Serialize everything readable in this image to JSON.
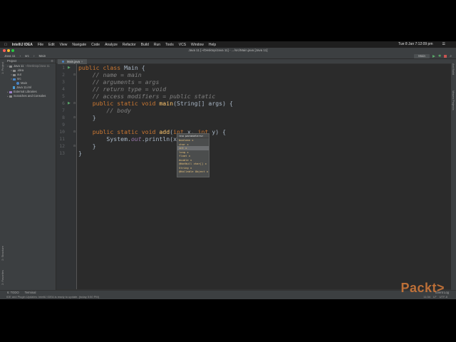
{
  "menubar": {
    "apple": "",
    "app": "IntelliJ IDEA",
    "items": [
      "File",
      "Edit",
      "View",
      "Navigate",
      "Code",
      "Analyze",
      "Refactor",
      "Build",
      "Run",
      "Tools",
      "VCS",
      "Window",
      "Help"
    ],
    "clock": "Tue 8 Jan 7:12:09 pm"
  },
  "window": {
    "title": "Java 11 [~/Desktop/Java 11] - .../src/Main.java [Java 11]"
  },
  "navbar": {
    "crumbs": [
      "Java 11",
      "src",
      "Main"
    ],
    "run_config": "Main"
  },
  "project_panel": {
    "title": "Project",
    "tree": [
      {
        "label": "Java 11",
        "hint": "~/Desktop/Java 11",
        "indent": 0,
        "icon": "folder"
      },
      {
        "label": ".idea",
        "hint": "",
        "indent": 1,
        "icon": "folder"
      },
      {
        "label": "out",
        "hint": "",
        "indent": 1,
        "icon": "folder"
      },
      {
        "label": "src",
        "hint": "",
        "indent": 1,
        "icon": "folder-src"
      },
      {
        "label": "Main",
        "hint": "",
        "indent": 2,
        "icon": "class"
      },
      {
        "label": "Java 11.iml",
        "hint": "",
        "indent": 1,
        "icon": "file"
      },
      {
        "label": "External Libraries",
        "hint": "",
        "indent": 0,
        "icon": "lib"
      },
      {
        "label": "Scratches and Consoles",
        "hint": "",
        "indent": 0,
        "icon": "folder"
      }
    ]
  },
  "left_strip": {
    "top": "1: Project",
    "middle": "2: Structure",
    "bottom": "2: Favorites"
  },
  "right_strip": {
    "top": "Ant Build",
    "middle": "Maven Projects"
  },
  "editor": {
    "tab": "Main.java",
    "line_numbers": [
      "1",
      "2",
      "3",
      "4",
      "5",
      "6",
      "7",
      "8",
      "9",
      "10",
      "11",
      "12",
      "13"
    ],
    "code": [
      [
        [
          "kw",
          "public class "
        ],
        [
          "",
          "Main {"
        ]
      ],
      [
        [
          "cm",
          "    // name = main"
        ]
      ],
      [
        [
          "cm",
          "    // arguments = args"
        ]
      ],
      [
        [
          "cm",
          "    // return type = void"
        ]
      ],
      [
        [
          "cm",
          "    // access modifiers = public static"
        ]
      ],
      [
        [
          "kw",
          "    public static void "
        ],
        [
          "fn",
          "main"
        ],
        [
          "",
          "(String[] args) {"
        ]
      ],
      [
        [
          "cm",
          "        // body"
        ]
      ],
      [
        [
          "",
          "    }"
        ]
      ],
      [
        [
          "",
          ""
        ]
      ],
      [
        [
          "kw",
          "    public static void "
        ],
        [
          "fn",
          "add"
        ],
        [
          "",
          "("
        ],
        [
          "kw",
          "int "
        ],
        [
          "",
          "x, "
        ],
        [
          "kw",
          "int "
        ],
        [
          "",
          "y) {"
        ]
      ],
      [
        [
          "",
          "        System."
        ],
        [
          "st",
          "out"
        ],
        [
          "",
          ".println(x + y)"
        ]
      ],
      [
        [
          "",
          "    }"
        ]
      ],
      [
        [
          "",
          "}"
        ]
      ]
    ]
  },
  "param_popup": {
    "header": "<no parameters>",
    "items": [
      "boolean x",
      "char x",
      "int x",
      "long x",
      "float x",
      "double x",
      "@NotNull char[] x",
      "String x",
      "@Nullable Object x"
    ],
    "selected_index": 2
  },
  "breadcrumbs": [
    "Main",
    "add()"
  ],
  "tool_windows": {
    "todo": "6: TODO",
    "terminal": "Terminal",
    "event_log": "Event Log"
  },
  "status": {
    "message": "IDE and Plugin Updates: IntelliJ IDEA is ready to update. (today 5:50 PM)",
    "position": "11:34",
    "line_sep": "LF",
    "encoding": "UTF-8"
  },
  "watermark": "Packt>"
}
